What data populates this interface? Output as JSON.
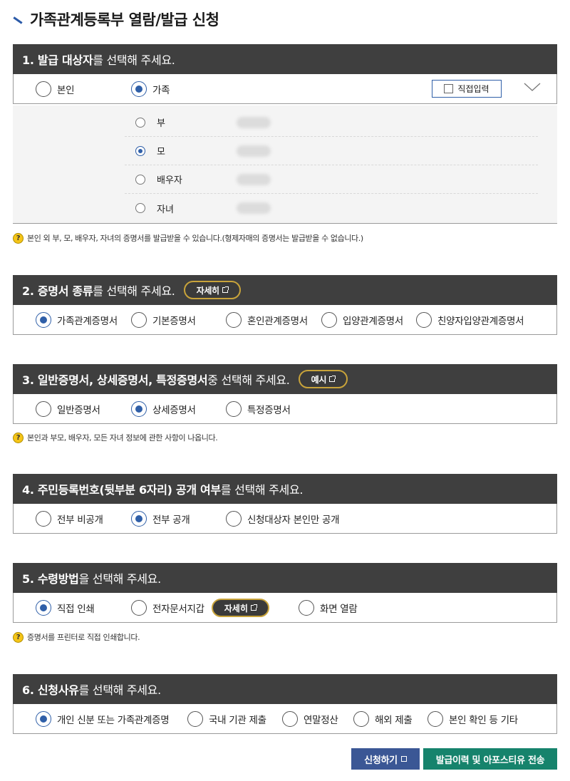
{
  "page": {
    "title": "가족관계등록부 열람/발급 신청"
  },
  "s1": {
    "head_bold": "1. 발급 대상자",
    "head_rest": "를 선택해 주세요.",
    "options": [
      {
        "label": "본인",
        "selected": false
      },
      {
        "label": "가족",
        "selected": true
      }
    ],
    "direct_input": "직접입력",
    "family": [
      {
        "label": "부",
        "selected": false
      },
      {
        "label": "모",
        "selected": true
      },
      {
        "label": "배우자",
        "selected": false
      },
      {
        "label": "자녀",
        "selected": false
      }
    ],
    "notice": "본인 외 부, 모, 배우자, 자녀의 증명서를 발급받을 수 있습니다.(형제자매의 증명서는 발급받을 수 없습니다.)"
  },
  "s2": {
    "head_bold": "2. 증명서 종류",
    "head_rest": "를 선택해 주세요.",
    "pill": "자세히",
    "options": [
      {
        "label": "가족관계증명서",
        "selected": true
      },
      {
        "label": "기본증명서",
        "selected": false
      },
      {
        "label": "혼인관계증명서",
        "selected": false
      },
      {
        "label": "입양관계증명서",
        "selected": false
      },
      {
        "label": "친양자입양관계증명서",
        "selected": false
      }
    ]
  },
  "s3": {
    "head_bold": "3. 일반증명서, 상세증명서, 특정증명서",
    "head_rest": " 중 선택해 주세요.",
    "pill": "예시",
    "options": [
      {
        "label": "일반증명서",
        "selected": false
      },
      {
        "label": "상세증명서",
        "selected": true
      },
      {
        "label": "특정증명서",
        "selected": false
      }
    ],
    "notice": "본인과 부모, 배우자, 모든 자녀 정보에 관한 사항이 나옵니다."
  },
  "s4": {
    "head_bold": "4. 주민등록번호(뒷부분 6자리) 공개 여부",
    "head_rest": "를 선택해 주세요.",
    "options": [
      {
        "label": "전부 비공개",
        "selected": false
      },
      {
        "label": "전부 공개",
        "selected": true
      },
      {
        "label": "신청대상자 본인만 공개",
        "selected": false
      }
    ]
  },
  "s5": {
    "head_bold": "5. 수령방법",
    "head_rest": "을 선택해 주세요.",
    "pill": "자세히",
    "options": [
      {
        "label": "직접 인쇄",
        "selected": true
      },
      {
        "label": "전자문서지갑",
        "selected": false
      },
      {
        "label": "화면 열람",
        "selected": false
      }
    ],
    "notice": "증명서를 프린터로 직접 인쇄합니다."
  },
  "s6": {
    "head_bold": "6. 신청사유",
    "head_rest": "를 선택해 주세요.",
    "options": [
      {
        "label": "개인 신분 또는 가족관계증명",
        "selected": true
      },
      {
        "label": "국내 기관 제출",
        "selected": false
      },
      {
        "label": "연말정산",
        "selected": false
      },
      {
        "label": "해외 제출",
        "selected": false
      },
      {
        "label": "본인 확인 등 기타",
        "selected": false
      }
    ]
  },
  "buttons": {
    "apply": "신청하기",
    "history": "발급이력 및 아포스티유 전송"
  },
  "colors": {
    "accent": "#2f5fa8",
    "header_bg": "#3f3f3f",
    "pill_border": "#c8a33a",
    "apply_bg": "#3b5795",
    "history_bg": "#16836c"
  },
  "icons": [
    "question-icon",
    "external-link-icon",
    "chevron-down-icon",
    "checkbox-icon"
  ]
}
